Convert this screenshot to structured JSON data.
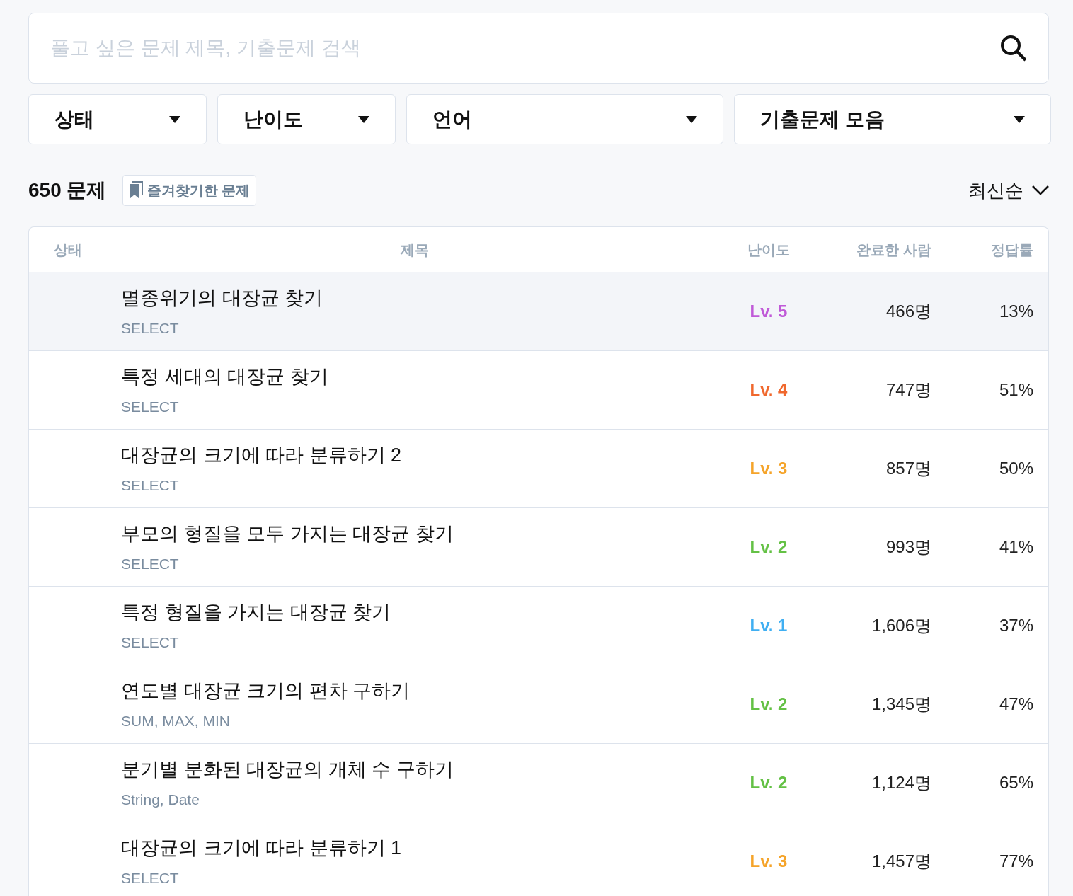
{
  "search": {
    "placeholder": "풀고 싶은 문제 제목, 기출문제 검색"
  },
  "filters": [
    {
      "label": "상태"
    },
    {
      "label": "난이도"
    },
    {
      "label": "언어"
    },
    {
      "label": "기출문제 모음"
    }
  ],
  "summary": {
    "count": "650 문제",
    "bookmark_label": "즐겨찾기한 문제",
    "sort": "최신순"
  },
  "table": {
    "columns": [
      "상태",
      "제목",
      "난이도",
      "완료한 사람",
      "정답률"
    ],
    "rows": [
      {
        "title": "멸종위기의 대장균 찾기",
        "tags": "SELECT",
        "level": "Lv. 5",
        "color": "#c05ad8",
        "completed": "466명",
        "rate": "13%",
        "hovered": true
      },
      {
        "title": "특정 세대의 대장균 찾기",
        "tags": "SELECT",
        "level": "Lv. 4",
        "color": "#f0682d",
        "completed": "747명",
        "rate": "51%",
        "hovered": false
      },
      {
        "title": "대장균의 크기에 따라 분류하기 2",
        "tags": "SELECT",
        "level": "Lv. 3",
        "color": "#f5a42a",
        "completed": "857명",
        "rate": "50%",
        "hovered": false
      },
      {
        "title": "부모의 형질을 모두 가지는 대장균 찾기",
        "tags": "SELECT",
        "level": "Lv. 2",
        "color": "#64c145",
        "completed": "993명",
        "rate": "41%",
        "hovered": false
      },
      {
        "title": "특정 형질을 가지는 대장균 찾기",
        "tags": "SELECT",
        "level": "Lv. 1",
        "color": "#40aff2",
        "completed": "1,606명",
        "rate": "37%",
        "hovered": false
      },
      {
        "title": "연도별 대장균 크기의 편차 구하기",
        "tags": "SUM, MAX, MIN",
        "level": "Lv. 2",
        "color": "#64c145",
        "completed": "1,345명",
        "rate": "47%",
        "hovered": false
      },
      {
        "title": "분기별 분화된 대장균의 개체 수 구하기",
        "tags": "String, Date",
        "level": "Lv. 2",
        "color": "#64c145",
        "completed": "1,124명",
        "rate": "65%",
        "hovered": false
      },
      {
        "title": "대장균의 크기에 따라 분류하기 1",
        "tags": "SELECT",
        "level": "Lv. 3",
        "color": "#f5a42a",
        "completed": "1,457명",
        "rate": "77%",
        "hovered": false
      }
    ]
  }
}
